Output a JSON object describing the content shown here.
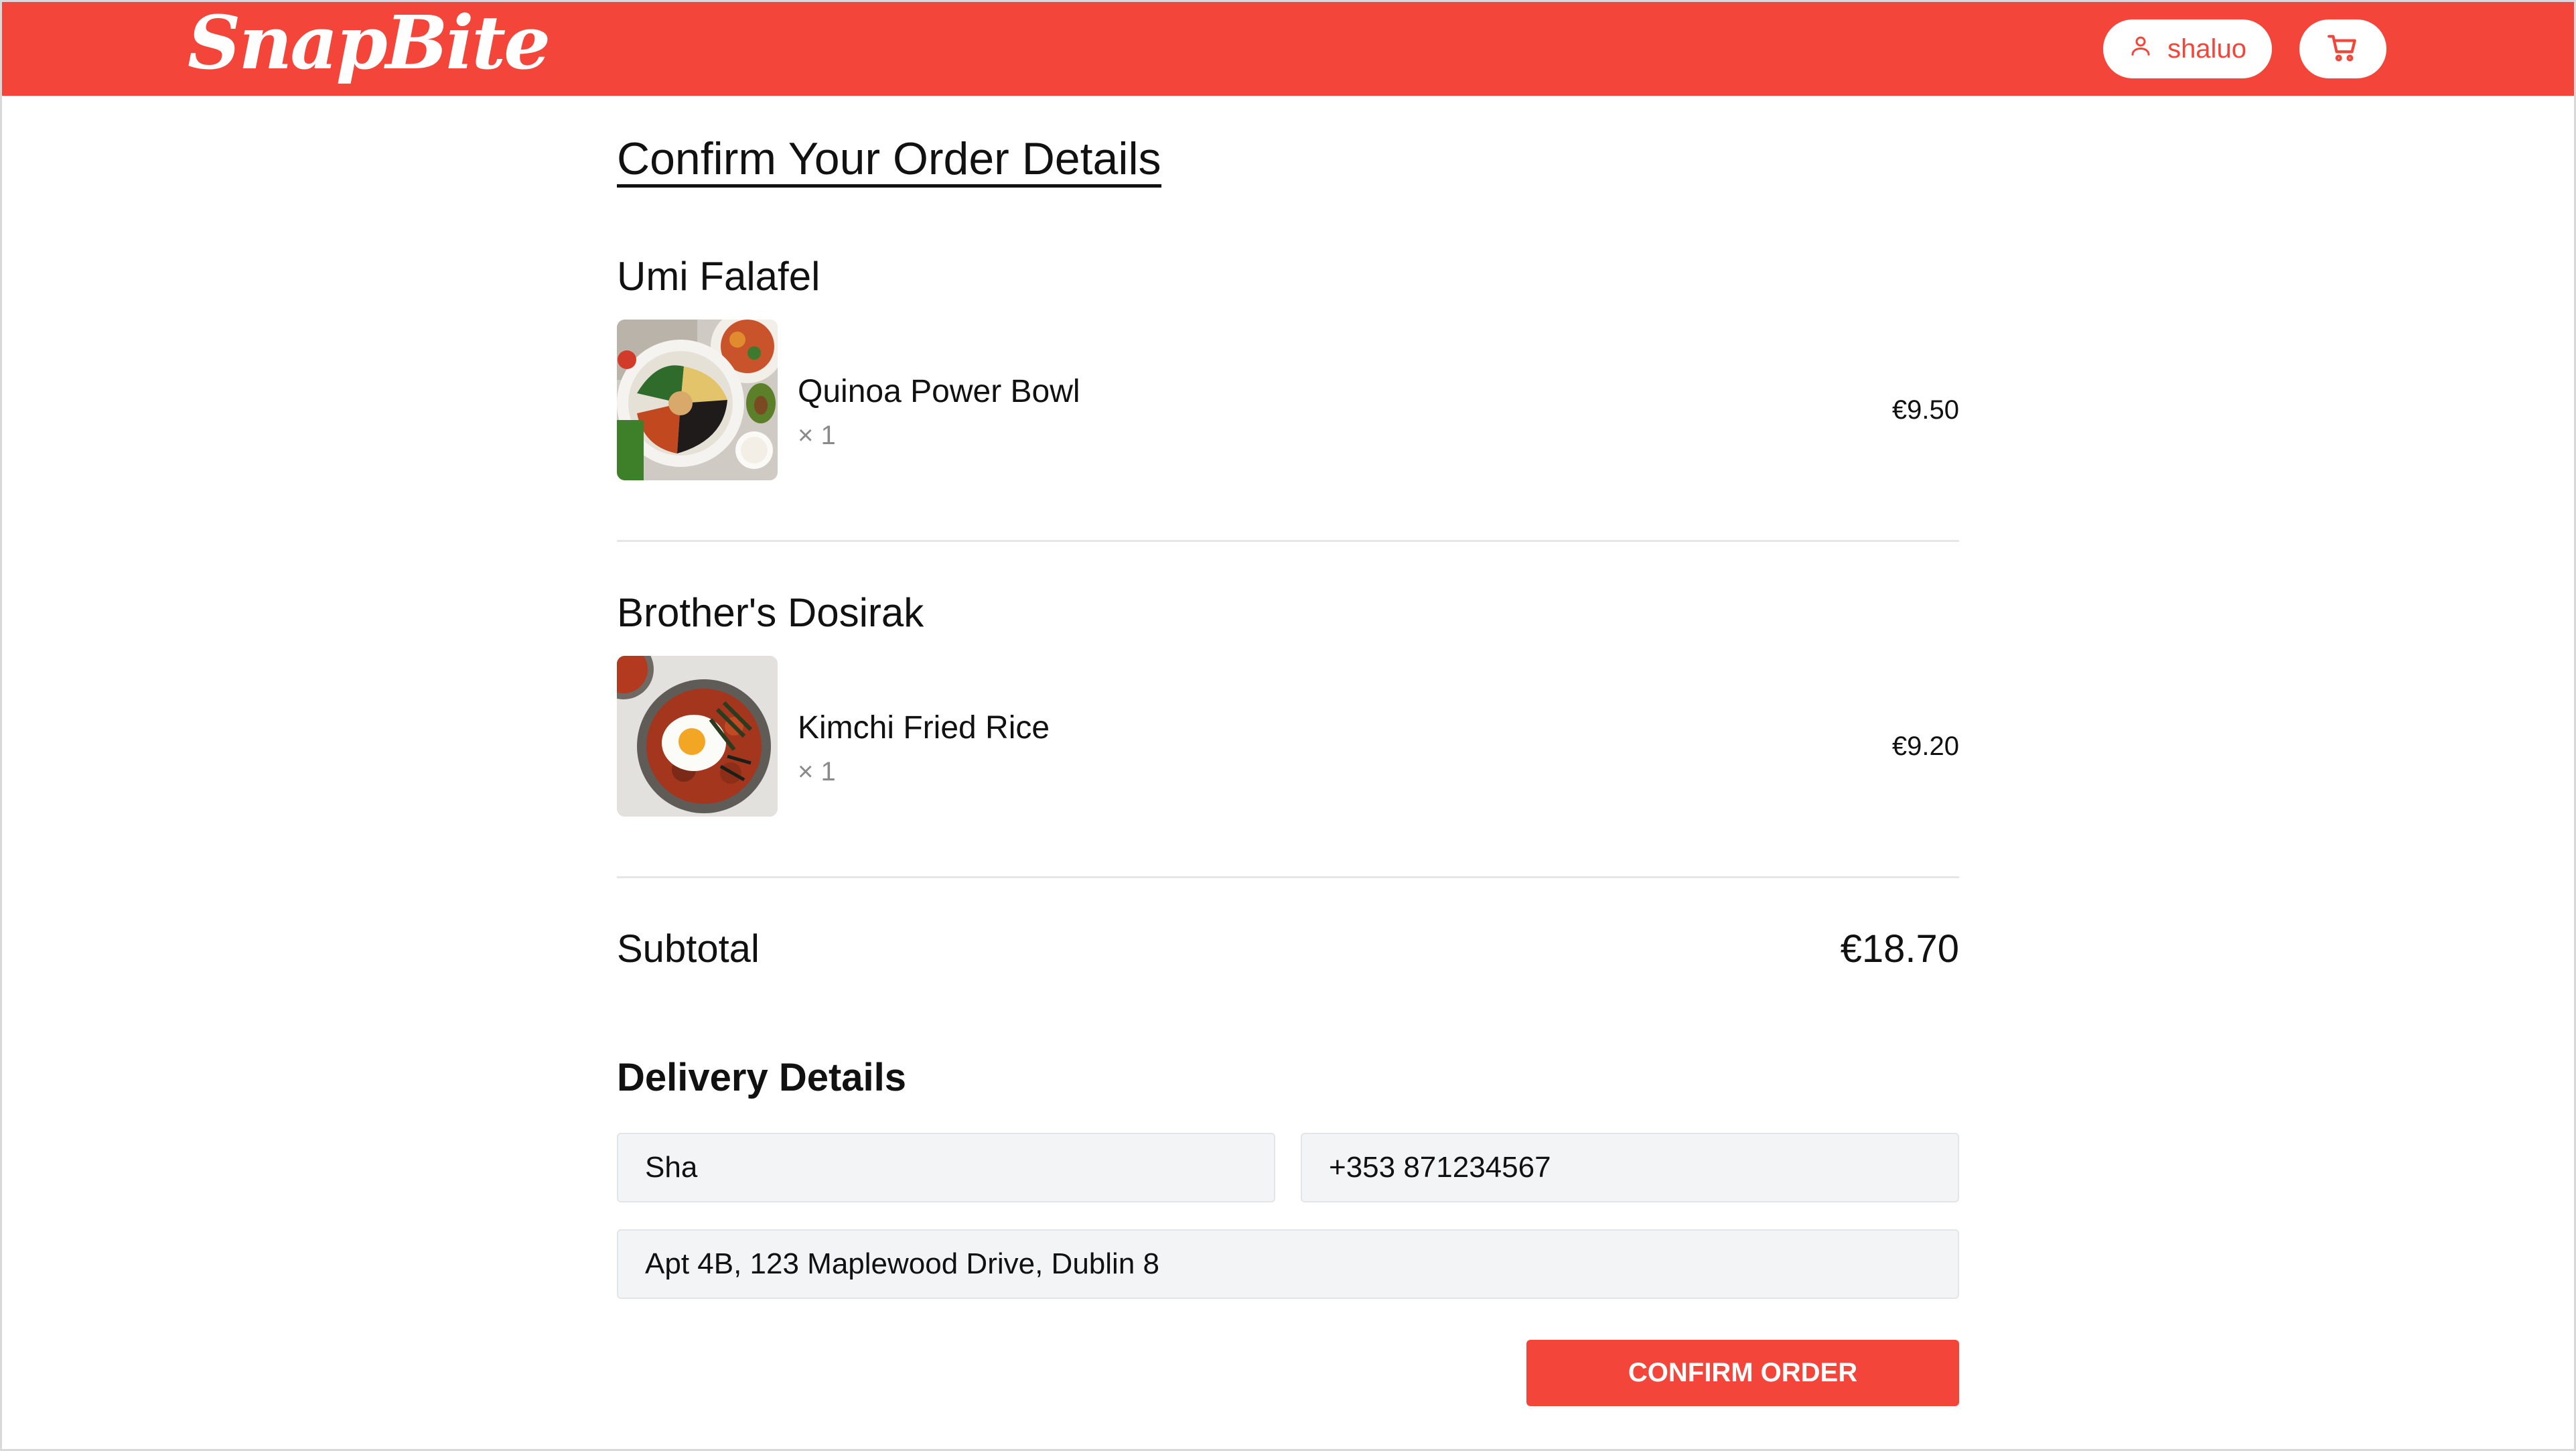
{
  "header": {
    "logo_text": "SnapBite",
    "user_label": "shaluo",
    "brand_color": "#f4453a",
    "user_icon": "user-icon",
    "cart_icon": "cart-icon"
  },
  "page": {
    "title": "Confirm Your Order Details"
  },
  "orders": [
    {
      "restaurant": "Umi Falafel",
      "items": [
        {
          "name": "Quinoa Power Bowl",
          "quantity": "× 1",
          "price": "€9.50"
        }
      ]
    },
    {
      "restaurant": "Brother's Dosirak",
      "items": [
        {
          "name": "Kimchi Fried Rice",
          "quantity": "× 1",
          "price": "€9.20"
        }
      ]
    }
  ],
  "subtotal": {
    "label": "Subtotal",
    "value": "€18.70"
  },
  "delivery": {
    "title": "Delivery Details",
    "name_value": "Sha",
    "phone_value": "+353 871234567",
    "address_value": "Apt 4B, 123 Maplewood Drive, Dublin 8"
  },
  "actions": {
    "confirm_label": "CONFIRM ORDER"
  }
}
